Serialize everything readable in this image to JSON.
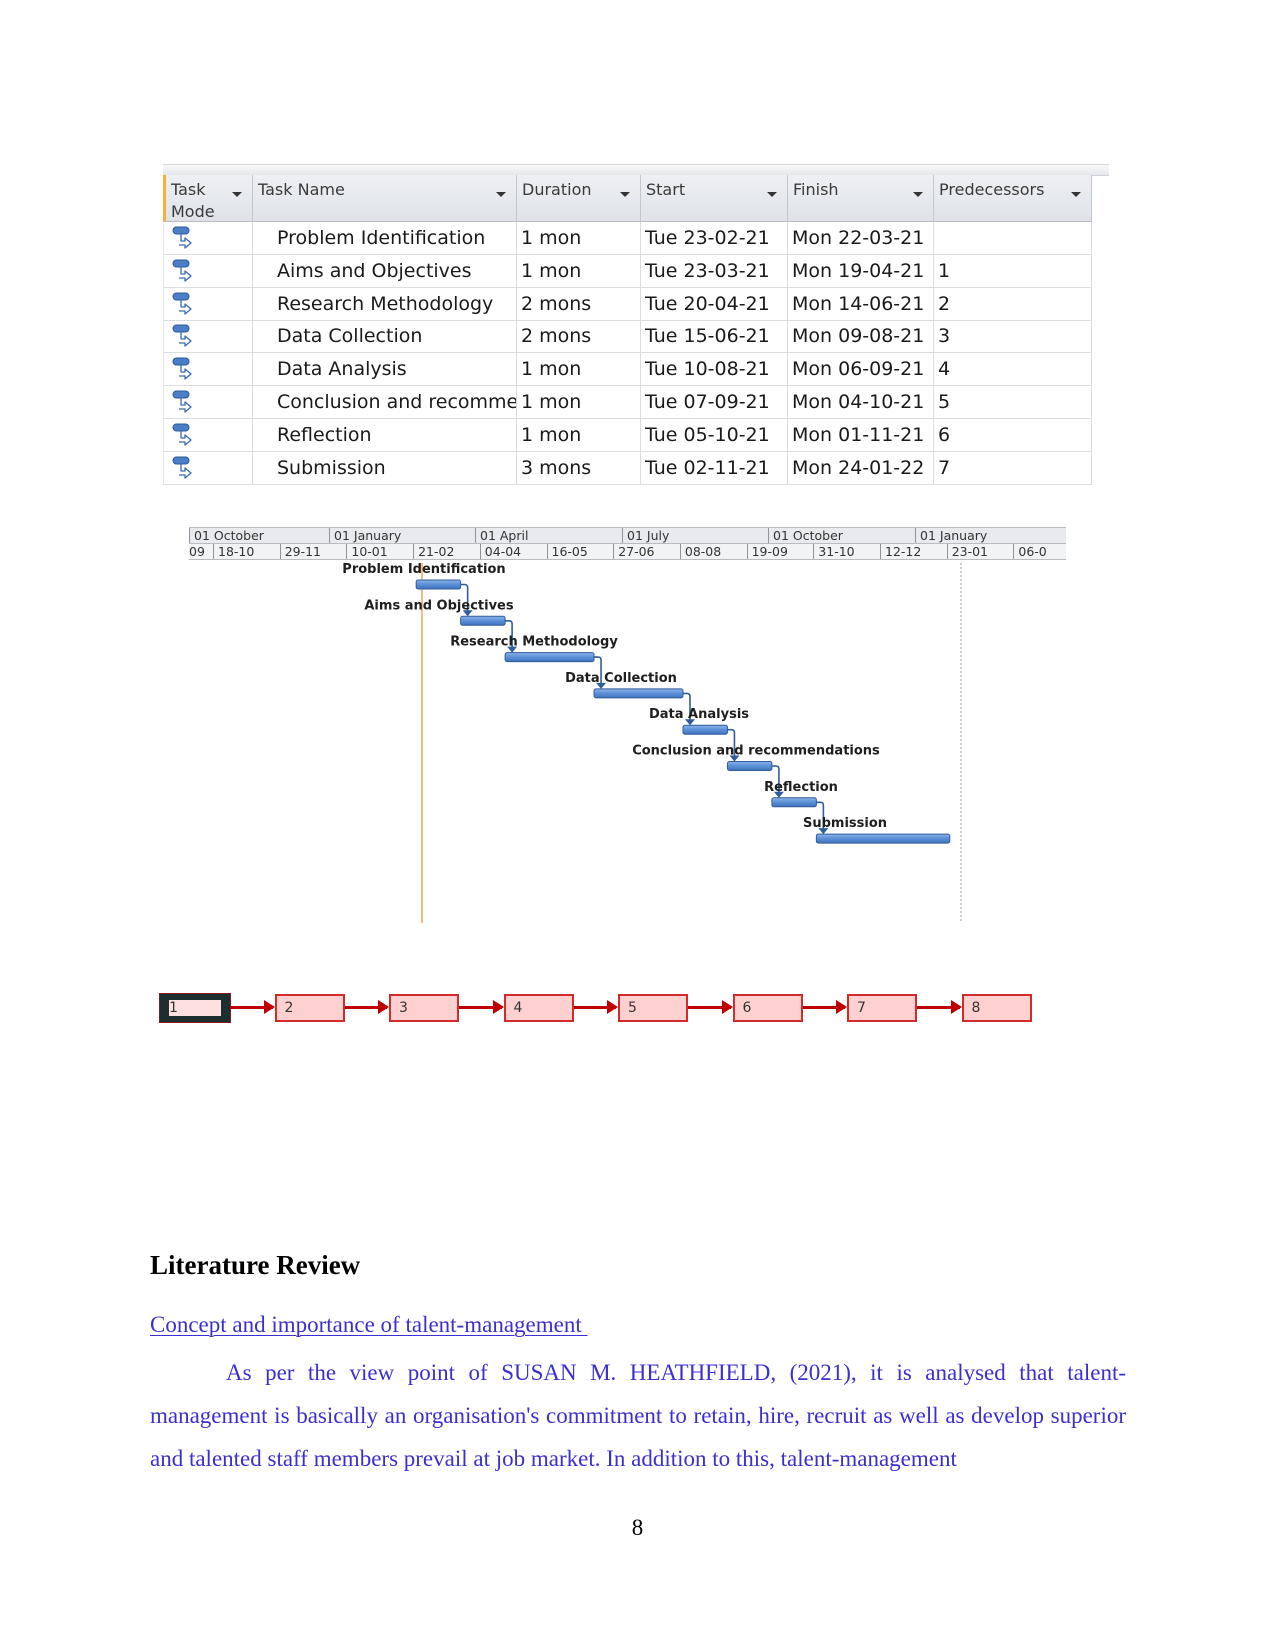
{
  "project_table": {
    "columns": [
      {
        "label": "Task Mode",
        "line1": "Task",
        "line2": "Mode"
      },
      {
        "label": "Task Name"
      },
      {
        "label": "Duration"
      },
      {
        "label": "Start"
      },
      {
        "label": "Finish"
      },
      {
        "label": "Predecessors"
      }
    ],
    "rows": [
      {
        "mode_icon": "auto-scheduled-task-icon",
        "name": "Problem Identification",
        "duration": "1 mon",
        "start": "Tue 23-02-21",
        "finish": "Mon 22-03-21",
        "predecessors": ""
      },
      {
        "mode_icon": "auto-scheduled-task-icon",
        "name": "Aims and Objectives",
        "duration": "1 mon",
        "start": "Tue 23-03-21",
        "finish": "Mon 19-04-21",
        "predecessors": "1"
      },
      {
        "mode_icon": "auto-scheduled-task-icon",
        "name": "Research Methodology",
        "duration": "2 mons",
        "start": "Tue 20-04-21",
        "finish": "Mon 14-06-21",
        "predecessors": "2"
      },
      {
        "mode_icon": "auto-scheduled-task-icon",
        "name": "Data Collection",
        "duration": "2 mons",
        "start": "Tue 15-06-21",
        "finish": "Mon 09-08-21",
        "predecessors": "3"
      },
      {
        "mode_icon": "auto-scheduled-task-icon",
        "name": "Data Analysis",
        "duration": "1 mon",
        "start": "Tue 10-08-21",
        "finish": "Mon 06-09-21",
        "predecessors": "4"
      },
      {
        "mode_icon": "auto-scheduled-task-icon",
        "name": "Conclusion and recomme",
        "duration": "1 mon",
        "start": "Tue 07-09-21",
        "finish": "Mon 04-10-21",
        "predecessors": "5"
      },
      {
        "mode_icon": "auto-scheduled-task-icon",
        "name": "Reflection",
        "duration": "1 mon",
        "start": "Tue 05-10-21",
        "finish": "Mon 01-11-21",
        "predecessors": "6"
      },
      {
        "mode_icon": "auto-scheduled-task-icon",
        "name": "Submission",
        "duration": "3 mons",
        "start": "Tue 02-11-21",
        "finish": "Mon 24-01-22",
        "predecessors": "7"
      }
    ]
  },
  "gantt": {
    "top_tier": [
      "01 October",
      "01 January",
      "01 April",
      "01 July",
      "01 October",
      "01 January"
    ],
    "bottom_tier": [
      "09",
      "18-10",
      "29-11",
      "10-01",
      "21-02",
      "04-04",
      "16-05",
      "27-06",
      "08-08",
      "19-09",
      "31-10",
      "12-12",
      "23-01",
      "06-0"
    ],
    "bars": [
      {
        "label": "Problem Identification",
        "start": "2021-02-23",
        "finish": "2021-03-22"
      },
      {
        "label": "Aims and Objectives",
        "start": "2021-03-23",
        "finish": "2021-04-19"
      },
      {
        "label": "Research Methodology",
        "start": "2021-04-20",
        "finish": "2021-06-14"
      },
      {
        "label": "Data Collection",
        "start": "2021-06-15",
        "finish": "2021-08-09"
      },
      {
        "label": "Data Analysis",
        "start": "2021-08-10",
        "finish": "2021-09-06"
      },
      {
        "label": "Conclusion and recommendations",
        "start": "2021-09-07",
        "finish": "2021-10-04"
      },
      {
        "label": "Reflection",
        "start": "2021-10-05",
        "finish": "2021-11-01"
      },
      {
        "label": "Submission",
        "start": "2021-11-02",
        "finish": "2022-01-24"
      }
    ],
    "colors": {
      "bar": "#5b8fd6",
      "bar_border": "#2f5c9a",
      "link": "#2f5c9a",
      "today_line": "#f4a460",
      "deadline_line": "#999999"
    }
  },
  "network": {
    "nodes": [
      "1",
      "2",
      "3",
      "4",
      "5",
      "6",
      "7",
      "8"
    ],
    "selected": "1",
    "colors": {
      "fill": "#ffd0d0",
      "border": "#d42a2a",
      "arrow": "#c00000"
    }
  },
  "document": {
    "heading": "Literature Review",
    "subheading": "Concept and importance of talent-management ",
    "paragraph": "As per the view point of SUSAN M. HEATHFIELD, (2021), it is analysed that talent-management is basically an organisation's commitment to retain, hire, recruit as well as develop superior and talented staff members prevail at job market. In addition to this, talent-management",
    "page_number": "8",
    "text_color": "#3a2fd0"
  }
}
